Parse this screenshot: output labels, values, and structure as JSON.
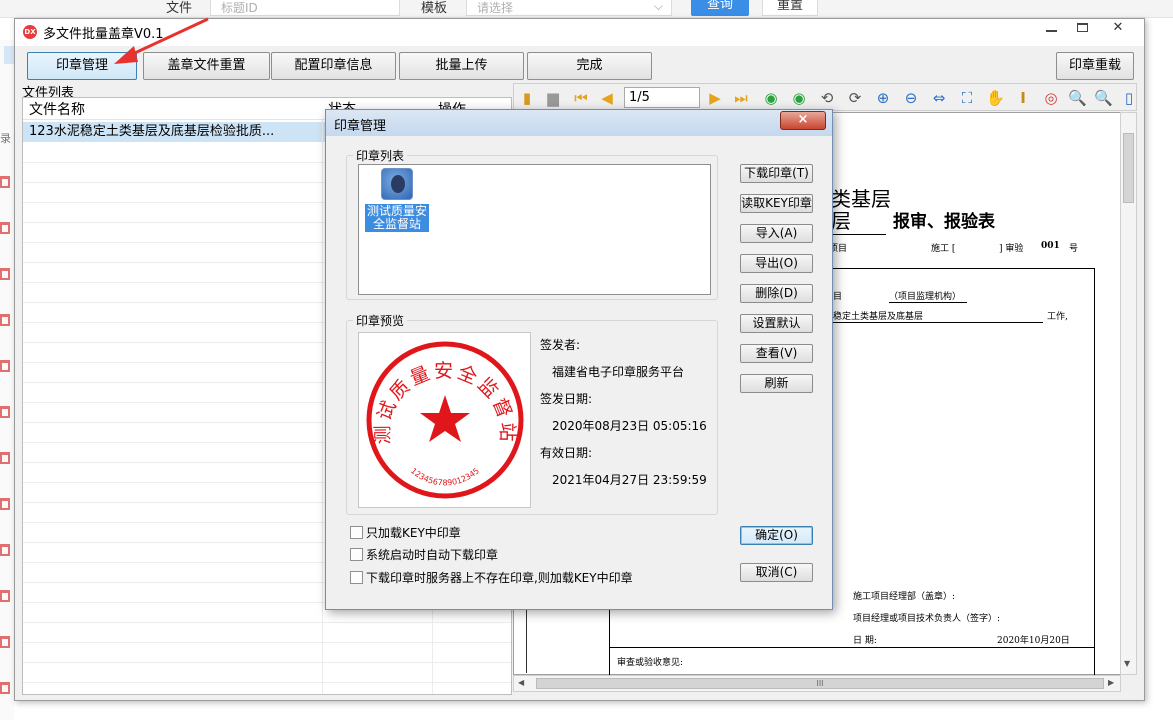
{
  "background_page": {
    "file_label": "文件",
    "title_placeholder": "标题ID",
    "template_label": "模板",
    "template_placeholder": "请选择",
    "query_button": "查询",
    "reset_button": "重置",
    "left_tag": "录"
  },
  "app": {
    "logo_text": "DX",
    "title": "多文件批量盖章V0.1",
    "toolbar": {
      "seal_manage": "印章管理",
      "restamp": "盖章文件重置",
      "config": "配置印章信息",
      "batch_upload": "批量上传",
      "finish": "完成",
      "seal_redo": "印章重载"
    },
    "file_list": {
      "caption": "文件列表",
      "columns": [
        "文件名称",
        "状态",
        "操作"
      ],
      "rows": [
        {
          "name": "123水泥稳定土类基层及底基层检验批质..."
        }
      ]
    }
  },
  "viewer": {
    "page_indicator": "1/5",
    "doc": {
      "heading_1": "类基层",
      "heading_2_prefix": "层",
      "heading_2": "报审、报验表",
      "row1_left": "项目",
      "row1_mid": "施工 [",
      "row1_right": "] 审验",
      "row1_num": "001",
      "row1_unit": "号",
      "org_prefix": "目",
      "org": "（项目监理机构）",
      "content": "稳定土类基层及底基层",
      "content_suffix": "工作,",
      "sign_dept": "施工项目经理部（盖章）:",
      "sign_person": "项目经理或项目技术负责人（签字）:",
      "sign_date_label": "日      期:",
      "sign_date": "2020年10月20日",
      "review_label": "审查或验收意见:"
    },
    "scroll_grip": "III"
  },
  "dialog": {
    "title": "印章管理",
    "close": "×",
    "seal_list_title": "印章列表",
    "seal_item_name": "测试质量安全监督站",
    "seal_preview_title": "印章预览",
    "seal_text": "测试质量安全监督站",
    "seal_code": "123456789012345",
    "issuer_label": "签发者:",
    "issuer": "福建省电子印章服务平台",
    "issue_date_label": "签发日期:",
    "issue_date": "2020年08月23日 05:05:16",
    "expire_label": "有效日期:",
    "expire_date": "2021年04月27日 23:59:59",
    "buttons": {
      "download": "下载印章(T)",
      "read_key": "读取KEY印章",
      "import": "导入(A)",
      "export": "导出(O)",
      "delete": "删除(D)",
      "set_default": "设置默认",
      "view": "查看(V)",
      "refresh": "刷新",
      "ok": "确定(O)",
      "cancel": "取消(C)"
    },
    "checkboxes": [
      "只加载KEY中印章",
      "系统启动时自动下载印章",
      "下载印章时服务器上不存在印章,则加载KEY中印章"
    ]
  },
  "colors": {
    "seal_red": "#e0161b",
    "accent_blue": "#3a8ee6",
    "selection": "#cde4f7"
  }
}
